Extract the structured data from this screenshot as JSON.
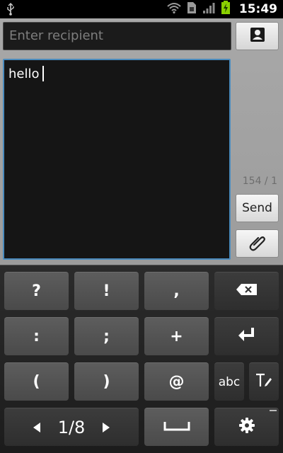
{
  "status_bar": {
    "time": "15:49",
    "icons": [
      "usb-icon",
      "wifi-icon",
      "sim-icon",
      "signal-icon",
      "battery-charging-icon"
    ]
  },
  "compose": {
    "recipient_placeholder": "Enter recipient",
    "message_text": "hello",
    "char_counter": "154 / 1",
    "send_label": "Send",
    "contact_icon": "contact-card-icon",
    "attach_icon": "paperclip-icon"
  },
  "keyboard": {
    "row1": [
      "?",
      "!",
      ","
    ],
    "row2": [
      ":",
      ";",
      "+"
    ],
    "row3": [
      "(",
      ")",
      "@",
      "abc"
    ],
    "page_indicator": "1/8",
    "icons": [
      "backspace-icon",
      "enter-icon",
      "handwriting-icon",
      "prev-page-icon",
      "next-page-icon",
      "space-icon",
      "settings-icon"
    ]
  },
  "colors": {
    "focus_border": "#4a8bbd",
    "key_light": "#555555",
    "key_dark": "#353535"
  }
}
